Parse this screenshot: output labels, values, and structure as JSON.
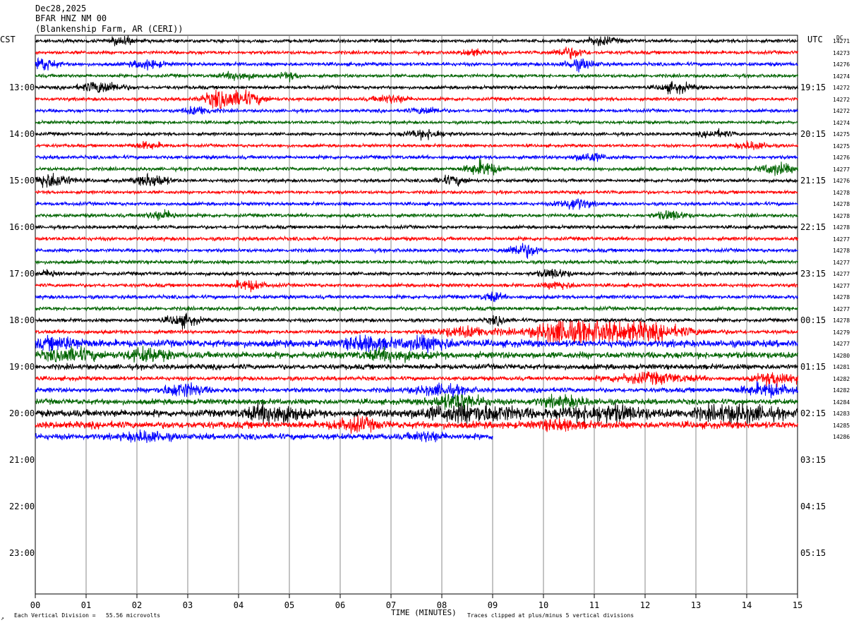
{
  "header": {
    "date": "Dec28,2025",
    "station": "BFAR HNZ NM 00",
    "location": "(Blankenship Farm, AR (CERI))"
  },
  "chart_data": {
    "type": "helicorder",
    "left_label": "CST",
    "right_label": "UTC",
    "dc_label": "DC",
    "xlabel": "TIME (MINUTES)",
    "x_ticks": [
      "00",
      "01",
      "02",
      "03",
      "04",
      "05",
      "06",
      "07",
      "08",
      "09",
      "10",
      "11",
      "12",
      "13",
      "14",
      "15"
    ],
    "xlim": [
      0,
      15
    ],
    "lines_per_hour": 4,
    "total_rows": 36,
    "left_hour_labels": [
      "13:00",
      "14:00",
      "15:00",
      "16:00",
      "17:00",
      "18:00",
      "19:00",
      "20:00",
      "21:00",
      "22:00",
      "23:00"
    ],
    "right_hour_labels": [
      "19:15",
      "20:15",
      "21:15",
      "22:15",
      "23:15",
      "00:15",
      "01:15",
      "02:15",
      "03:15",
      "04:15",
      "05:15"
    ],
    "trace_colors": [
      "#000000",
      "#ff0000",
      "#0000ff",
      "#006400"
    ],
    "dc_offsets": [
      14271,
      14273,
      14276,
      14274,
      14272,
      14272,
      14272,
      14274,
      14275,
      14275,
      14276,
      14277,
      14276,
      14278,
      14278,
      14278,
      14278,
      14277,
      14278,
      14277,
      14277,
      14277,
      14278,
      14277,
      14278,
      14279,
      14277,
      14280,
      14281,
      14282,
      14282,
      14284,
      14283,
      14285,
      14286
    ],
    "last_trace_end_minute": 9.0,
    "footer_left": "Each Vertical Division =   55.56 microvolts",
    "footer_right": "Traces clipped at plus/minus 5 vertical divisions",
    "corner_mark": "↗"
  }
}
